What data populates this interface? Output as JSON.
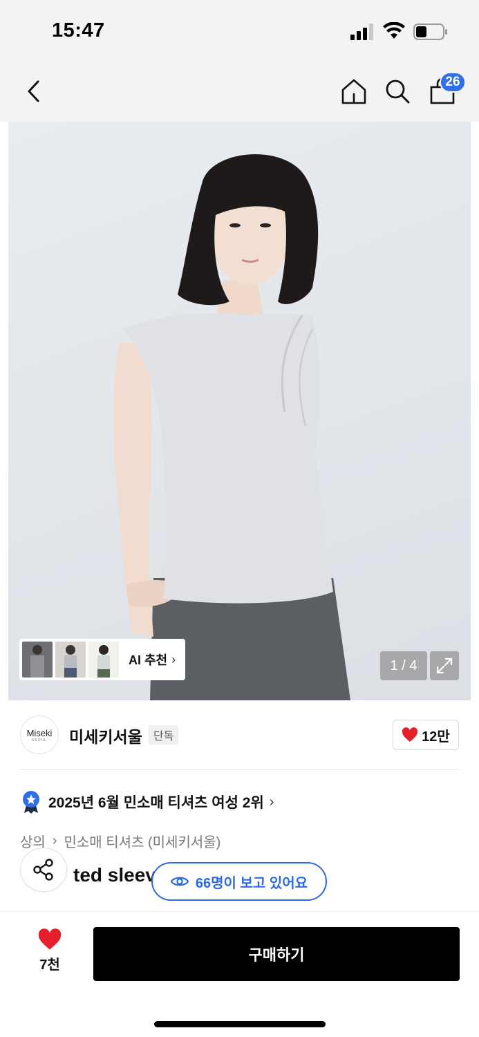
{
  "status_bar": {
    "time": "15:47"
  },
  "navbar": {
    "back_icon": "chevron-left-icon",
    "home_icon": "home-icon",
    "search_icon": "search-icon",
    "cart_icon": "shopping-bag-icon",
    "cart_count": "26"
  },
  "gallery": {
    "page_indicator": "1 / 4",
    "ai_recommend_label": "AI 추천",
    "ai_recommend_chevron": "›",
    "expand_icon": "expand-icon"
  },
  "brand": {
    "logo_text": "Miseki",
    "logo_sub": "SEOUL",
    "name": "미세키서울",
    "tag": "단독",
    "like_count": "12만"
  },
  "ranking": {
    "icon": "award-badge-icon",
    "text": "2025년 6월 민소매 티셔츠 여성 2위",
    "chevron": "›"
  },
  "breadcrumb": {
    "items": [
      "상의",
      "민소매 티셔츠 (미세키서울)"
    ],
    "separator": "›"
  },
  "product": {
    "title_partial": "ted sleev"
  },
  "viewers": {
    "text": "66명이 보고 있어요"
  },
  "bottom_bar": {
    "like_count": "7천",
    "buy_label": "구매하기"
  },
  "colors": {
    "accent_blue": "#2d6ae0",
    "heart_red": "#e5202a",
    "buy_bg": "#000000"
  }
}
